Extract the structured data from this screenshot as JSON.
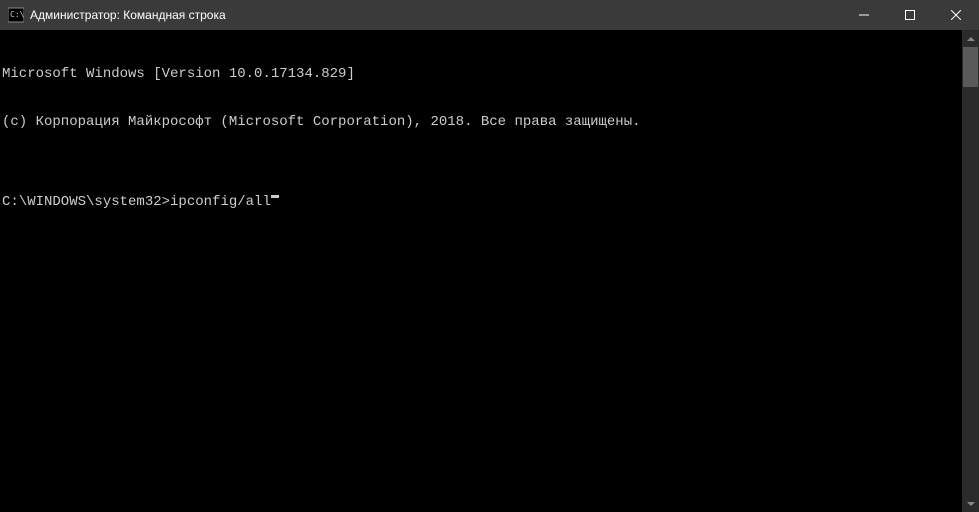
{
  "window": {
    "title": "Администратор: Командная строка"
  },
  "terminal": {
    "line1": "Microsoft Windows [Version 10.0.17134.829]",
    "line2": "(c) Корпорация Майкрософт (Microsoft Corporation), 2018. Все права защищены.",
    "blank": "",
    "prompt": "C:\\WINDOWS\\system32>",
    "command": "ipconfig/all"
  }
}
